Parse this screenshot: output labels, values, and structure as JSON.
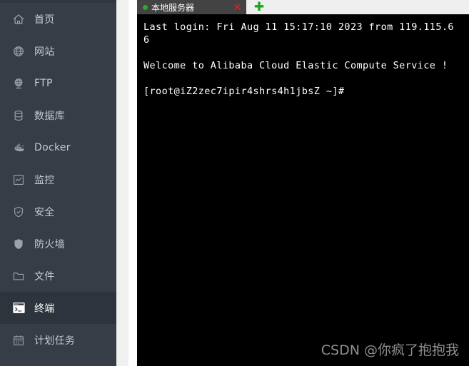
{
  "sidebar": {
    "items": [
      {
        "label": "首页",
        "icon": "home-icon",
        "active": false
      },
      {
        "label": "网站",
        "icon": "globe-icon",
        "active": false
      },
      {
        "label": "FTP",
        "icon": "ftp-icon",
        "active": false
      },
      {
        "label": "数据库",
        "icon": "database-icon",
        "active": false
      },
      {
        "label": "Docker",
        "icon": "docker-icon",
        "active": false
      },
      {
        "label": "监控",
        "icon": "monitor-icon",
        "active": false
      },
      {
        "label": "安全",
        "icon": "shield-check-icon",
        "active": false
      },
      {
        "label": "防火墙",
        "icon": "shield-solid-icon",
        "active": false
      },
      {
        "label": "文件",
        "icon": "folder-icon",
        "active": false
      },
      {
        "label": "终端",
        "icon": "terminal-icon",
        "active": true
      },
      {
        "label": "计划任务",
        "icon": "calendar-icon",
        "active": false
      }
    ]
  },
  "terminal": {
    "tab": {
      "title": "本地服务器",
      "status_dot": "green-dot-icon",
      "close_label": "✕",
      "add_label": "✚"
    },
    "lines": [
      "Last login: Fri Aug 11 15:17:10 2023 from 119.115.6",
      "6",
      "",
      "Welcome to Alibaba Cloud Elastic Compute Service !",
      "",
      "[root@iZ2zec7ipir4shrs4h1jbsZ ~]#"
    ]
  },
  "watermark": {
    "text": "CSDN @你疯了抱抱我"
  },
  "colors": {
    "sidebar_bg": "#363d47",
    "sidebar_active_bg": "#2e343d",
    "sidebar_text": "#c3cad3",
    "terminal_bg": "#000000",
    "terminal_text": "#ffffff",
    "tab_bar_bg": "#efeff0",
    "tab_active_bg": "#434343",
    "tab_dot": "#2fa82f",
    "tab_close": "#e02020",
    "tab_add": "#1aa81a",
    "watermark": "#8f8f8f"
  }
}
